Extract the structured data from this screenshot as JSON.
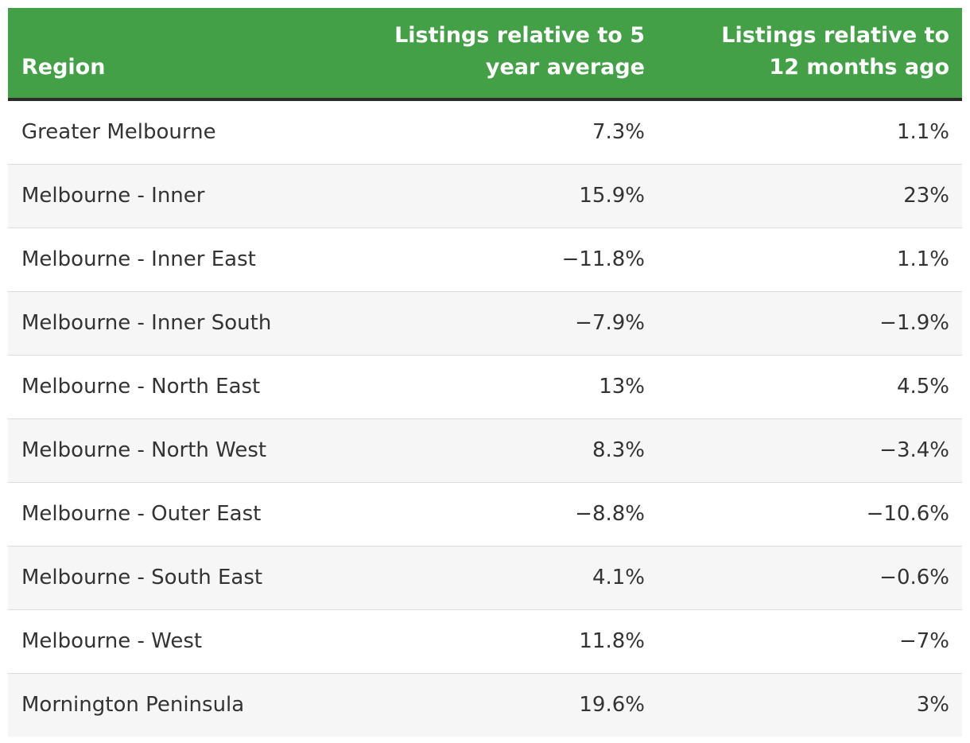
{
  "chart_data": {
    "type": "table",
    "columns": [
      "Region",
      "Listings relative to 5 year average",
      "Listings relative to 12 months ago"
    ],
    "rows": [
      [
        "Greater Melbourne",
        "7.3%",
        "1.1%"
      ],
      [
        "Melbourne - Inner",
        "15.9%",
        "23%"
      ],
      [
        "Melbourne - Inner East",
        "−11.8%",
        "1.1%"
      ],
      [
        "Melbourne - Inner South",
        "−7.9%",
        "−1.9%"
      ],
      [
        "Melbourne - North East",
        "13%",
        "4.5%"
      ],
      [
        "Melbourne - North West",
        "8.3%",
        "−3.4%"
      ],
      [
        "Melbourne - Outer East",
        "−8.8%",
        "−10.6%"
      ],
      [
        "Melbourne - South East",
        "4.1%",
        "−0.6%"
      ],
      [
        "Melbourne - West",
        "11.8%",
        "−7%"
      ],
      [
        "Mornington Peninsula",
        "19.6%",
        "3%"
      ]
    ]
  },
  "colors": {
    "header_bg": "#43a047",
    "header_text": "#ffffff",
    "header_border": "#2b2b2b",
    "stripe": "#f6f6f6",
    "text": "#333333"
  }
}
